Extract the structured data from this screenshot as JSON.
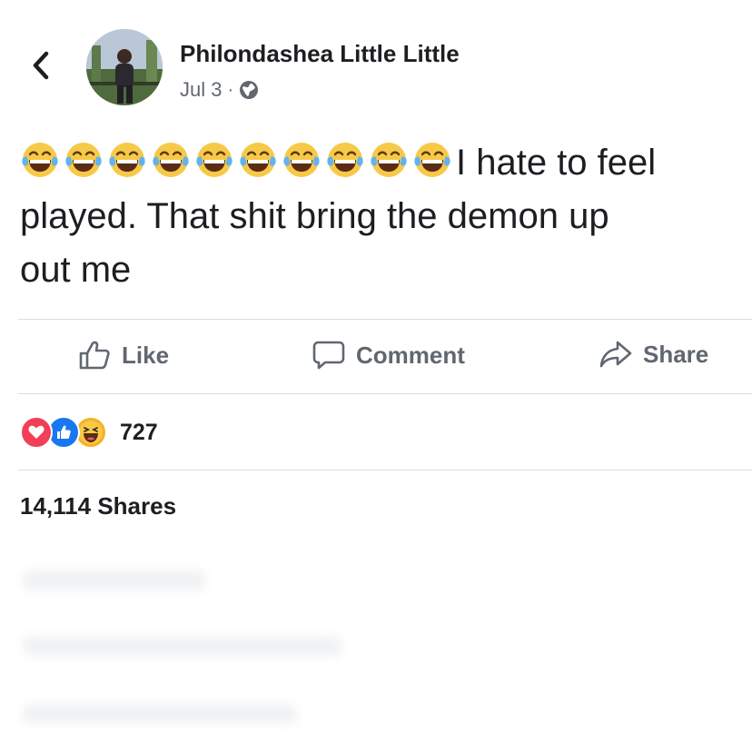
{
  "post": {
    "author": "Philondashea Little Little",
    "date": "Jul 3",
    "separator": "·",
    "privacy_icon": "globe-icon",
    "emoji_prefix_count": 10,
    "emoji_icon": "tears-of-joy-emoji",
    "text_line1": "I hate to feel",
    "text_line2": "played. That shit bring the demon up",
    "text_line3": "out me"
  },
  "actions": {
    "like_label": "Like",
    "comment_label": "Comment",
    "share_label": "Share"
  },
  "stats": {
    "reaction_icons": [
      "love-reaction-icon",
      "like-reaction-icon",
      "haha-reaction-icon"
    ],
    "reactions_count": "727",
    "shares": "14,114 Shares"
  },
  "colors": {
    "text": "#1c1e21",
    "muted": "#606770",
    "divider": "#dadde1",
    "like_blue": "#1877f2",
    "love_red": "#f33e58",
    "haha_yellow": "#f7b125"
  }
}
